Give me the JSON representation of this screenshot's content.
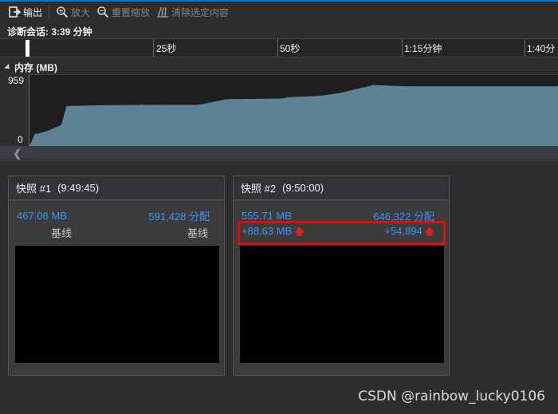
{
  "toolbar": {
    "export_label": "输出",
    "zoom_in_label": "放大",
    "reset_zoom_label": "重置缩放",
    "clear_selection_label": "清除选定内容"
  },
  "session": {
    "label": "诊断会话: 3:39 分钟"
  },
  "timeline": {
    "ticks": [
      "25秒",
      "50秒",
      "1:15分钟",
      "1:40分"
    ]
  },
  "memory": {
    "title": "内存 (MB)",
    "y_max_label": "959",
    "y_min_label": "0"
  },
  "chart_data": {
    "type": "area",
    "title": "内存 (MB)",
    "ylim": [
      0,
      959
    ],
    "x_unit": "seconds",
    "x": [
      0,
      1,
      3,
      6,
      7,
      8,
      14,
      21,
      25,
      32,
      37,
      38,
      48,
      49,
      55,
      59,
      65,
      72,
      100
    ],
    "values": [
      0,
      175,
      210,
      310,
      590,
      595,
      605,
      610,
      610,
      610,
      690,
      695,
      705,
      725,
      745,
      790,
      905,
      885,
      885
    ],
    "color": "#5e8397"
  },
  "snapshots": [
    {
      "title": "快照 #1",
      "time": "(9:49:45)",
      "size": "467.08 MB",
      "allocations": "591,428 分配",
      "size_baseline": "基线",
      "alloc_baseline": "基线"
    },
    {
      "title": "快照 #2",
      "time": "(9:50:00)",
      "size": "555.71 MB",
      "allocations": "646,322 分配",
      "size_diff": "+88.63 MB",
      "alloc_diff": "+54,894"
    }
  ],
  "colors": {
    "accent": "#007acc",
    "link": "#3794ff",
    "increase": "#e51e1e",
    "highlight": "#e00d0d"
  },
  "watermark": "CSDN @rainbow_lucky0106"
}
